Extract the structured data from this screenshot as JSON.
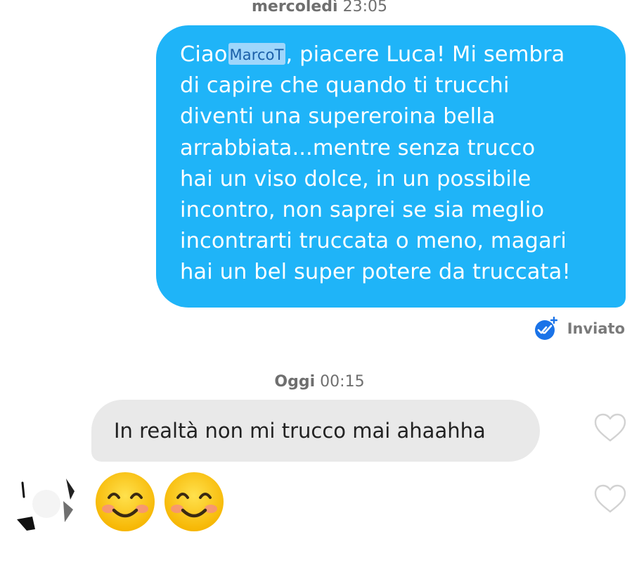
{
  "thread": {
    "timestamp1": {
      "day": "mercoledì",
      "time": "23:05"
    },
    "sent_message": {
      "lines": [
        {
          "before": "Ciao",
          "name": "MarcoT",
          "after": ", piacere Luca! Mi sembra"
        },
        "di capire che quando ti trucchi",
        "diventi una supereroina bella",
        "arrabbiata...mentre senza trucco",
        "hai un viso dolce, in un possibile",
        "incontro, non saprei se sia meglio",
        "incontrarti truccata o meno, magari",
        "hai un bel super potere da truccata!"
      ],
      "status": "Inviato",
      "status_icon": "double-check-boost-icon"
    },
    "timestamp2": {
      "day": "Oggi",
      "time": "00:15"
    },
    "received_message": {
      "text": "In realtà non mi trucco mai ahaahha"
    },
    "emoji_message": {
      "emojis": [
        "smiling-face-icon",
        "smiling-face-icon"
      ]
    },
    "heart_icons": [
      "heart-outline-icon",
      "heart-outline-icon"
    ]
  },
  "colors": {
    "sent_bubble": "#1fb4f8",
    "received_bubble": "#e9e9e9",
    "status_icon": "#1a73e8",
    "timestamp_text": "#6f6f6f"
  }
}
